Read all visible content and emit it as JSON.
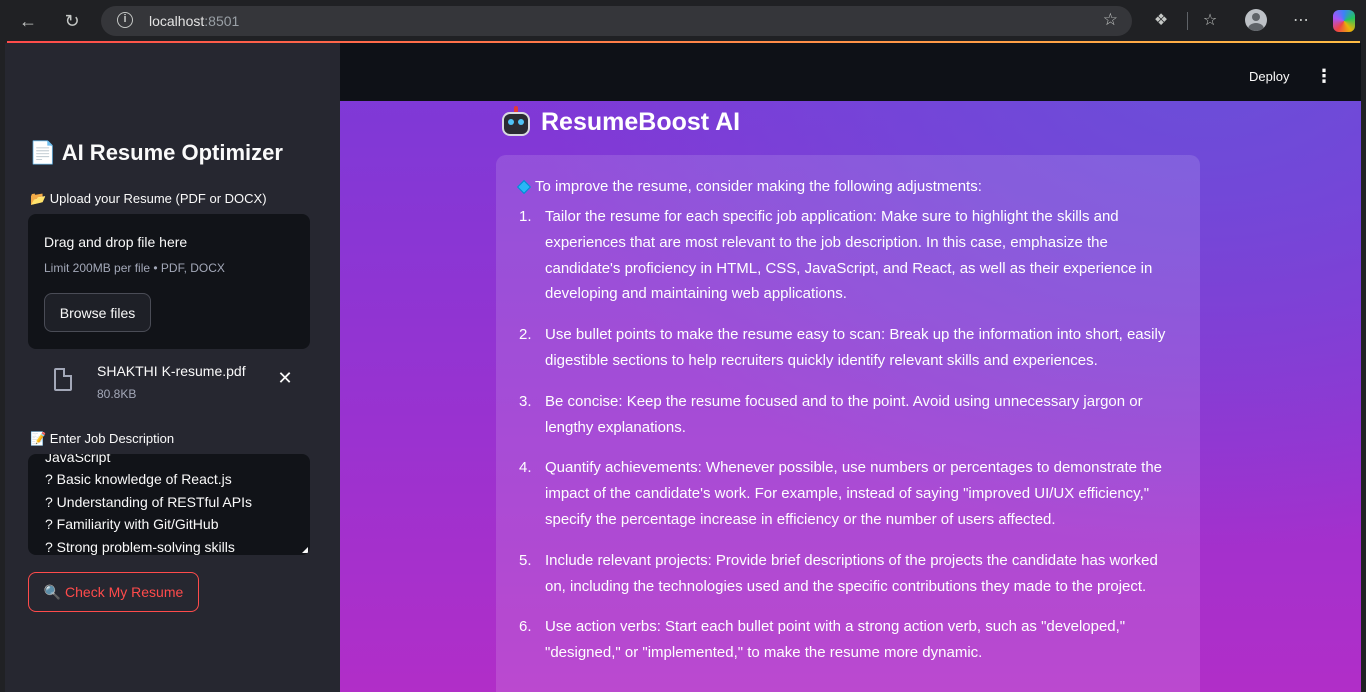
{
  "browser": {
    "url_host": "localhost",
    "url_port": ":8501"
  },
  "sidebar": {
    "title": "📄 AI Resume Optimizer",
    "upload_label": "📂 Upload your Resume (PDF or DOCX)",
    "uploader": {
      "drag_text": "Drag and drop file here",
      "limit_text": "Limit 200MB per file • PDF, DOCX",
      "browse_label": "Browse files"
    },
    "uploaded_file": {
      "name": "SHAKTHI K-resume.pdf",
      "size": "80.8KB"
    },
    "jd_label": "📝 Enter Job Description",
    "jd_lines": [
      "JavaScript",
      "? Basic knowledge of React.js",
      "? Understanding of RESTful APIs",
      "? Familiarity with Git/GitHub",
      "? Strong problem-solving skills"
    ],
    "check_button": "🔍 Check My Resume"
  },
  "header": {
    "deploy_label": "Deploy",
    "menu_label": "⋮"
  },
  "main": {
    "title": "ResumeBoost AI",
    "intro": "To improve the resume, consider making the following adjustments:",
    "steps": [
      {
        "num": "1.",
        "text": "Tailor the resume for each specific job application: Make sure to highlight the skills and experiences that are most relevant to the job description. In this case, emphasize the candidate's proficiency in HTML, CSS, JavaScript, and React, as well as their experience in developing and maintaining web applications."
      },
      {
        "num": "2.",
        "text": "Use bullet points to make the resume easy to scan: Break up the information into short, easily digestible sections to help recruiters quickly identify relevant skills and experiences."
      },
      {
        "num": "3.",
        "text": "Be concise: Keep the resume focused and to the point. Avoid using unnecessary jargon or lengthy explanations."
      },
      {
        "num": "4.",
        "text": "Quantify achievements: Whenever possible, use numbers or percentages to demonstrate the impact of the candidate's work. For example, instead of saying \"improved UI/UX efficiency,\" specify the percentage increase in efficiency or the number of users affected."
      },
      {
        "num": "5.",
        "text": "Include relevant projects: Provide brief descriptions of the projects the candidate has worked on, including the technologies used and the specific contributions they made to the project."
      },
      {
        "num": "6.",
        "text": "Use action verbs: Start each bullet point with a strong action verb, such as \"developed,\" \"designed,\" or \"implemented,\" to make the resume more dynamic."
      }
    ]
  },
  "colors": {
    "accent": "#ff4b4b",
    "sidebar_bg": "#262730",
    "header_bg": "#0e1117"
  }
}
